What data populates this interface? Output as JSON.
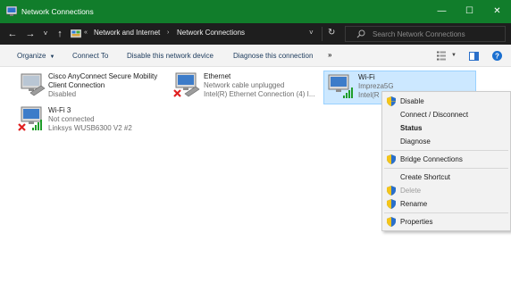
{
  "window": {
    "title": "Network Connections",
    "minimize_glyph": "—",
    "maximize_glyph": "☐",
    "close_glyph": "✕"
  },
  "address": {
    "back_glyph": "←",
    "forward_glyph": "→",
    "recent_glyph": "˅",
    "up_glyph": "↑",
    "overflow_glyph": "«",
    "crumb_1": "Network and Internet",
    "crumb_sep": "›",
    "crumb_2": "Network Connections",
    "dropdown_glyph": "˅",
    "refresh_glyph": "↻",
    "search_placeholder": "Search Network Connections"
  },
  "toolbar": {
    "organize": "Organize",
    "connect_to": "Connect To",
    "disable_device": "Disable this network device",
    "diagnose": "Diagnose this connection",
    "more": "»"
  },
  "connections": [
    {
      "name": "Cisco AnyConnect Secure Mobility",
      "name_line2": "Client Connection",
      "status": "Disabled",
      "device": ""
    },
    {
      "name": "Ethernet",
      "status": "Network cable unplugged",
      "device": "Intel(R) Ethernet Connection (4) I..."
    },
    {
      "name": "Wi-Fi",
      "status": "Impreza5G",
      "device": "Intel(R"
    },
    {
      "name": "Wi-Fi 3",
      "status": "Not connected",
      "device": "Linksys WUSB6300 V2 #2"
    }
  ],
  "context_menu": {
    "disable": "Disable",
    "connect_disconnect": "Connect / Disconnect",
    "status": "Status",
    "diagnose": "Diagnose",
    "bridge": "Bridge Connections",
    "create_shortcut": "Create Shortcut",
    "delete": "Delete",
    "rename": "Rename",
    "properties": "Properties"
  },
  "colors": {
    "titlebar": "#117d2b",
    "addressbar": "#1e1e1e",
    "selection": "#cce8ff",
    "shield_blue": "#2a6fc9",
    "shield_yellow": "#f5c518"
  },
  "icons": {
    "app": "network-connections-icon",
    "search": "search-icon",
    "shield": "uac-shield-icon"
  }
}
